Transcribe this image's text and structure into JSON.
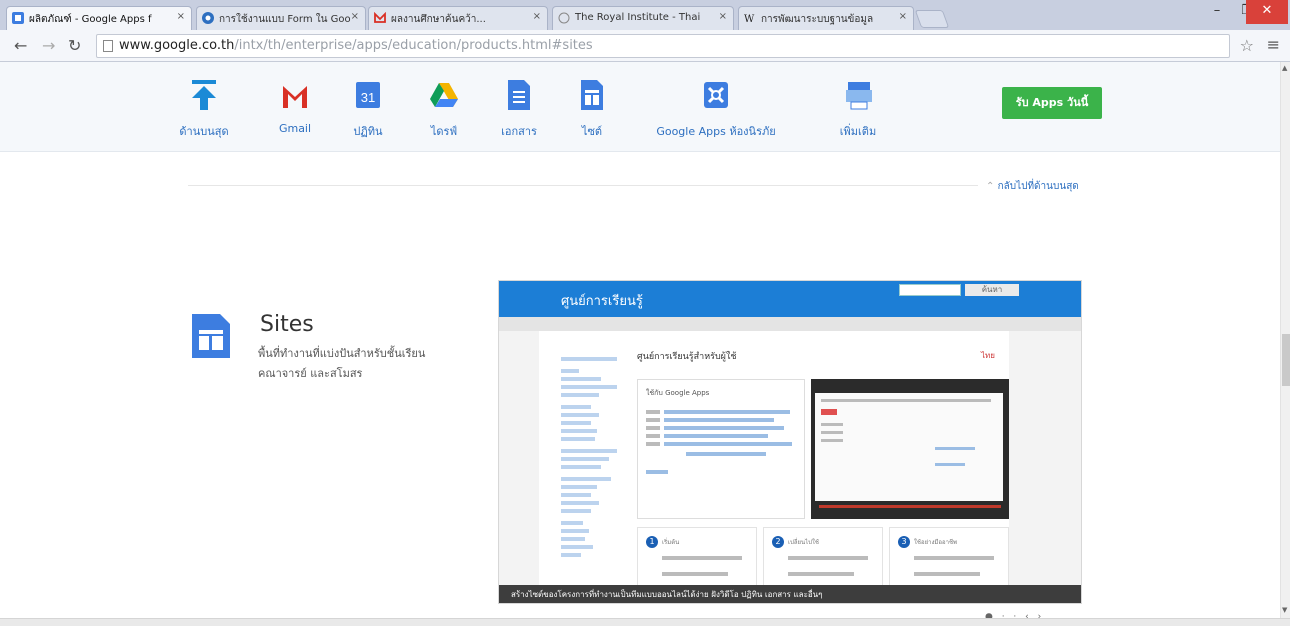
{
  "browser": {
    "tabs": [
      {
        "title": "ผลิตภัณฑ์ - Google Apps f",
        "active": true,
        "icon": "google-apps-favicon",
        "color": "#3d7de0"
      },
      {
        "title": "การใช้งานแบบ Form ใน Goo",
        "active": false,
        "icon": "chrome-favicon",
        "color": "#2d6fc0"
      },
      {
        "title": "ผลงานศึกษาค้นคว้า...",
        "active": false,
        "icon": "gmail-favicon",
        "color": "#d93025"
      },
      {
        "title": "The Royal Institute - Thai",
        "active": false,
        "icon": "page-favicon",
        "color": "#888888"
      },
      {
        "title": "การพัฒนาระบบฐานข้อมูล",
        "active": false,
        "icon": "wikipedia-favicon",
        "color": "#222222"
      }
    ],
    "close_glyph": "×",
    "url_host": "www.google.co.th",
    "url_path": "/intx/th/enterprise/apps/education/products.html#sites",
    "window_buttons": {
      "minimize": "–",
      "restore": "❐",
      "close": "✕"
    }
  },
  "appbar": {
    "items": [
      {
        "label": "ด้านบนสุด",
        "icon": "arrow-top-icon"
      },
      {
        "label": "Gmail",
        "icon": "gmail-icon"
      },
      {
        "label": "ปฏิทิน",
        "icon": "calendar-icon",
        "icon_text": "31"
      },
      {
        "label": "ไดรฟ์",
        "icon": "drive-icon"
      },
      {
        "label": "เอกสาร",
        "icon": "docs-icon"
      },
      {
        "label": "ไซต์",
        "icon": "sites-icon"
      },
      {
        "label": "Google Apps ห้องนิรภัย",
        "icon": "vault-icon"
      },
      {
        "label": "เพิ่มเติม",
        "icon": "more-icon"
      }
    ],
    "cta": "รับ Apps วันนี้"
  },
  "main": {
    "back_to_top": "กลับไปที่ด้านบนสุด",
    "section_title": "Sites",
    "section_desc": "พื้นที่ทำงานที่แบ่งปันสำหรับชั้นเรียน คณาจารย์ และสโมสร"
  },
  "mockup": {
    "header_title": "ศูนย์การเรียนรู้",
    "search_button": "ค้นหา",
    "heading": "ศูนย์การเรียนรู้สำหรับผู้ใช้",
    "language": "ไทย",
    "card_title": "ใช้กับ Google Apps",
    "steps": [
      "เริ่มต้น",
      "เปลี่ยนไปใช้",
      "ใช้อย่างมืออาชีพ"
    ],
    "caption": "สร้างไซต์ของโครงการที่ทำงานเป็นทีมแบบออนไลน์ได้ง่าย ฝังวิดีโอ ปฏิทิน เอกสาร และอื่นๆ"
  },
  "colors": {
    "accent": "#2d6fc0",
    "cta": "#3bb34a",
    "mock_header": "#1c7ed6"
  }
}
